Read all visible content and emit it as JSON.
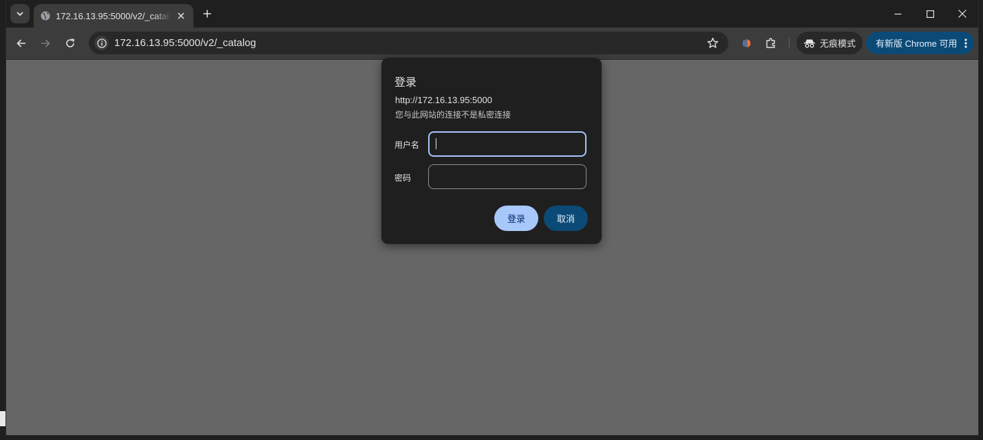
{
  "browser": {
    "tab_title": "172.16.13.95:5000/v2/_catalog",
    "url": "172.16.13.95:5000/v2/_catalog",
    "incognito_label": "无痕模式",
    "update_label": "有新版 Chrome 可用"
  },
  "dialog": {
    "title": "登录",
    "origin": "http://172.16.13.95:5000",
    "warning": "您与此网站的连接不是私密连接",
    "username_label": "用户名",
    "username_value": "",
    "password_label": "密码",
    "password_value": "",
    "login_button": "登录",
    "cancel_button": "取消"
  },
  "colors": {
    "page_bg": "#666666",
    "dialog_bg": "#1f1f1f",
    "primary_button": "#a8c7fa",
    "secondary_button": "#0b4a76",
    "focus_ring": "#a8c7fa"
  }
}
